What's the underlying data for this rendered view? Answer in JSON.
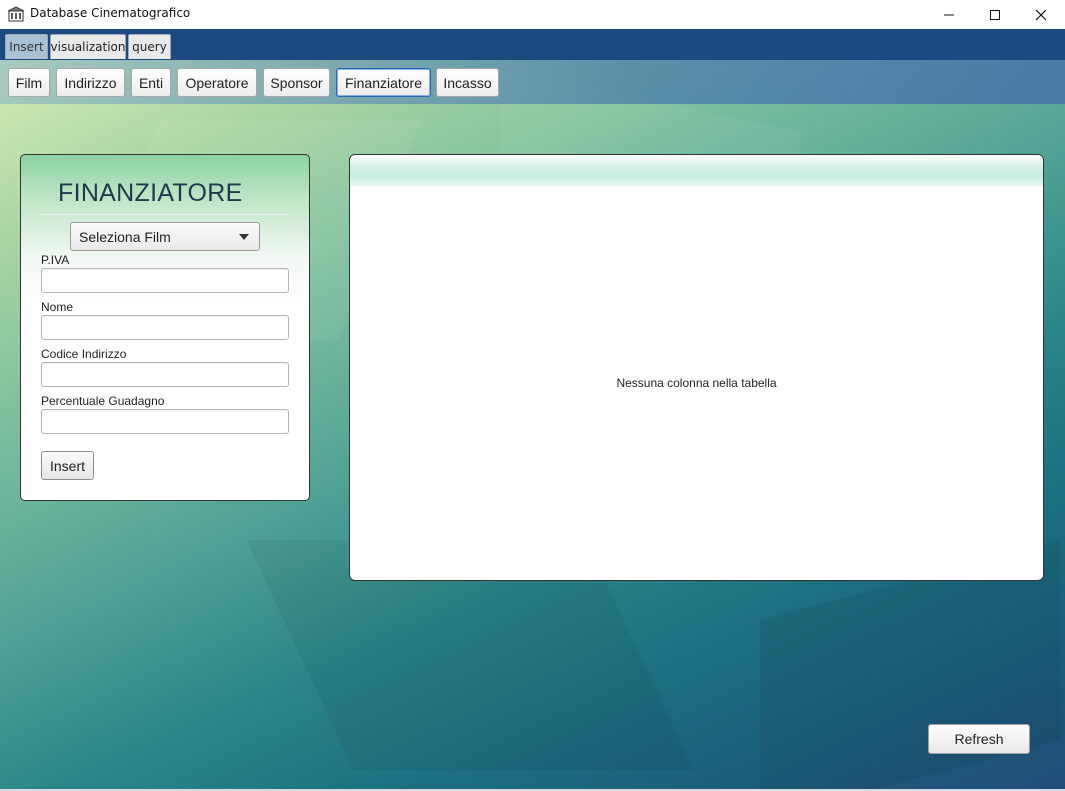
{
  "window": {
    "title": "Database Cinematografico",
    "icon": "building-icon",
    "controls": [
      "minimize-icon",
      "maximize-icon",
      "close-icon"
    ]
  },
  "main_tabs": [
    {
      "label": "Insert",
      "selected": true
    },
    {
      "label": "visualization",
      "selected": false
    },
    {
      "label": "query",
      "selected": false
    }
  ],
  "sub_buttons": [
    {
      "label": "Film",
      "active": false
    },
    {
      "label": "Indirizzo",
      "active": false
    },
    {
      "label": "Enti",
      "active": false
    },
    {
      "label": "Operatore",
      "active": false
    },
    {
      "label": "Sponsor",
      "active": false
    },
    {
      "label": "Finanziatore",
      "active": true
    },
    {
      "label": "Incasso",
      "active": false
    }
  ],
  "form": {
    "title": "FINANZIATORE",
    "select_label": "Seleziona Film",
    "fields": [
      {
        "label": "P.IVA",
        "value": ""
      },
      {
        "label": "Nome",
        "value": ""
      },
      {
        "label": "Codice Indirizzo",
        "value": ""
      },
      {
        "label": "Percentuale Guadagno",
        "value": ""
      }
    ],
    "submit_label": "Insert"
  },
  "table": {
    "empty_message": "Nessuna colonna nella tabella"
  },
  "refresh_label": "Refresh",
  "colors": {
    "tabstrip": "#1c4a80",
    "active_button_border": "#2a67b7",
    "panel_header": "#c7ece2"
  }
}
